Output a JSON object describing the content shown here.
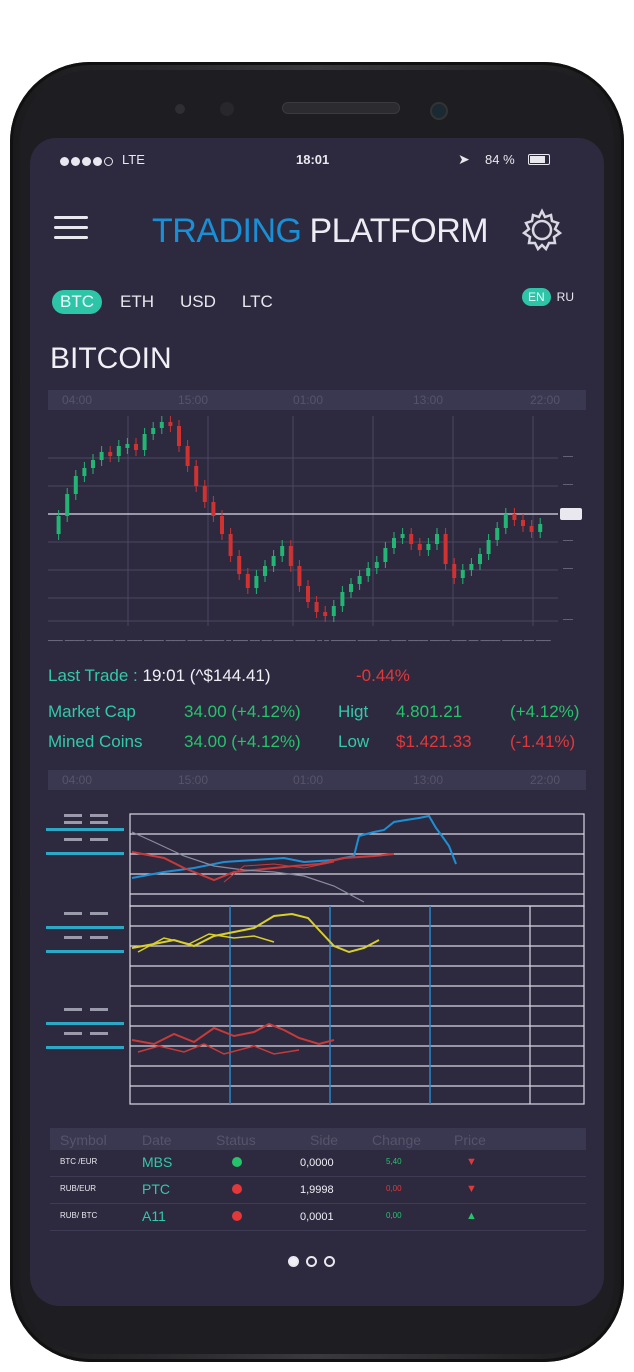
{
  "status_bar": {
    "carrier": "LTE",
    "time": "18:01",
    "battery": "84 %"
  },
  "header": {
    "title_part1": "TRADING",
    "title_part2": "PLATFORM",
    "menu_icon": "hamburger-icon",
    "settings_icon": "gear-icon"
  },
  "currency_tabs": [
    {
      "label": "BTC",
      "active": true
    },
    {
      "label": "ETH",
      "active": false
    },
    {
      "label": "USD",
      "active": false
    },
    {
      "label": "LTC",
      "active": false
    }
  ],
  "language": {
    "options": [
      "EN",
      "RU"
    ],
    "selected": "EN"
  },
  "coin_title": "BITCOIN",
  "time_axis": [
    "04:00",
    "15:00",
    "01:00",
    "13:00",
    "22:00"
  ],
  "stats": {
    "last_trade_label": "Last Trade :",
    "last_trade_value": "19:01 (^$144.41)",
    "last_trade_change": "-0.44%",
    "market_cap_label": "Market Cap",
    "market_cap_value": "34.00 (+4.12%)",
    "high_label": "Higt",
    "high_value": "4.801.21",
    "high_change": "(+4.12%)",
    "mined_coins_label": "Mined Coins",
    "mined_coins_value": "34.00 (+4.12%)",
    "low_label": "Low",
    "low_value": "$1.421.33",
    "low_change": "(-1.41%)"
  },
  "table": {
    "headers": [
      "Symbol",
      "Date",
      "Status",
      "Side",
      "Change",
      "Price"
    ],
    "rows": [
      {
        "symbol": "BTC /EUR",
        "date": "MBS",
        "status": "green",
        "side": "0,0000",
        "change": "5,40",
        "change_color": "green",
        "price_dir": "down"
      },
      {
        "symbol": "RUB/EUR",
        "date": "PTC",
        "status": "red",
        "side": "1,9998",
        "change": "0,00",
        "change_color": "red",
        "price_dir": "down"
      },
      {
        "symbol": "RUB/ BTC",
        "date": "A11",
        "status": "red",
        "side": "0,0001",
        "change": "0,00",
        "change_color": "green",
        "price_dir": "up"
      }
    ]
  },
  "pager": {
    "pages": 3,
    "current": 1
  },
  "colors": {
    "background": "#2d2a3f",
    "accent_teal": "#2ec4a8",
    "brand_blue": "#1a8fd6",
    "up_green": "#25c46b",
    "down_red": "#e2383a"
  }
}
